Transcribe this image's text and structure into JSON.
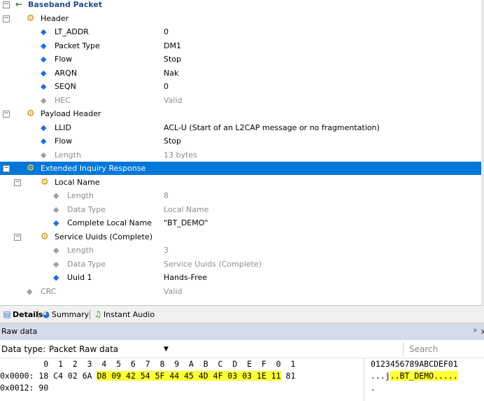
{
  "tree": {
    "rows": [
      {
        "label": "Baseband Packet",
        "value": "",
        "level": 0,
        "icon": "arrow",
        "bold": true,
        "toggle": true
      },
      {
        "label": "Header",
        "value": "",
        "level": 1,
        "icon": "gear",
        "toggle": true
      },
      {
        "label": "LT_ADDR",
        "value": "0",
        "level": 2,
        "icon": "diamond"
      },
      {
        "label": "Packet Type",
        "value": "DM1",
        "level": 2,
        "icon": "diamond"
      },
      {
        "label": "Flow",
        "value": "Stop",
        "level": 2,
        "icon": "diamond"
      },
      {
        "label": "ARQN",
        "value": "Nak",
        "level": 2,
        "icon": "diamond"
      },
      {
        "label": "SEQN",
        "value": "0",
        "level": 2,
        "icon": "diamond"
      },
      {
        "label": "HEC",
        "value": "Valid",
        "level": 2,
        "icon": "diamond",
        "grey": true
      },
      {
        "label": "Payload Header",
        "value": "",
        "level": 1,
        "icon": "gear",
        "toggle": true
      },
      {
        "label": "LLID",
        "value": "ACL-U (Start of an L2CAP message or no fragmentation)",
        "level": 2,
        "icon": "diamond"
      },
      {
        "label": "Flow",
        "value": "Stop",
        "level": 2,
        "icon": "diamond"
      },
      {
        "label": "Length",
        "value": "13 bytes",
        "level": 2,
        "icon": "diamond",
        "grey": true
      },
      {
        "label": "Extended Inquiry Response",
        "value": "",
        "level": 1,
        "icon": "gear",
        "toggle": true,
        "selected": true
      },
      {
        "label": "Local Name",
        "value": "",
        "level": 2,
        "icon": "gear",
        "toggle": true
      },
      {
        "label": "Length",
        "value": "8",
        "level": 3,
        "icon": "diamond",
        "grey": true
      },
      {
        "label": "Data Type",
        "value": "Local Name",
        "level": 3,
        "icon": "diamond",
        "grey": true
      },
      {
        "label": "Complete Local Name",
        "value": "\"BT_DEMO\"",
        "level": 3,
        "icon": "diamond"
      },
      {
        "label": "Service Uuids (Complete)",
        "value": "",
        "level": 2,
        "icon": "gear",
        "toggle": true
      },
      {
        "label": "Length",
        "value": "3",
        "level": 3,
        "icon": "diamond",
        "grey": true
      },
      {
        "label": "Data Type",
        "value": "Service Uuids (Complete)",
        "level": 3,
        "icon": "diamond",
        "grey": true
      },
      {
        "label": "Uuid 1",
        "value": "Hands-Free",
        "level": 3,
        "icon": "diamond"
      },
      {
        "label": "CRC",
        "value": "Valid",
        "level": 1,
        "icon": "diamond",
        "grey": true
      }
    ]
  },
  "tabs": [
    {
      "label": "Details",
      "icon": "details-icon",
      "active": true
    },
    {
      "label": "Summary",
      "icon": "summary-icon"
    },
    {
      "label": "Instant Audio",
      "icon": "music-note-icon"
    }
  ],
  "raw": {
    "title": "Raw data",
    "pin": "ᵖ",
    "close": "x",
    "data_type_label": "Data type:",
    "data_type_value": "Packet Raw data",
    "search_placeholder": "Search",
    "header_hex": "         0  1  2  3  4  5  6  7  8  9  A  B  C  D  E  F  0  1",
    "header_ascii": "0123456789ABCDEF01",
    "lines": [
      {
        "addr": "0x0000:",
        "pre": " 18 C4 02 6A ",
        "hl": "D8 09 42 54 5F 44 45 4D 4F 03 03 1E 11",
        "post": " 81",
        "ascii_pre": "...j",
        "ascii_hl": "..BT_DEMO.....",
        "ascii_post": ""
      },
      {
        "addr": "0x0012:",
        "pre": " 90",
        "hl": "",
        "post": "",
        "ascii_pre": ".",
        "ascii_hl": "",
        "ascii_post": ""
      }
    ]
  }
}
